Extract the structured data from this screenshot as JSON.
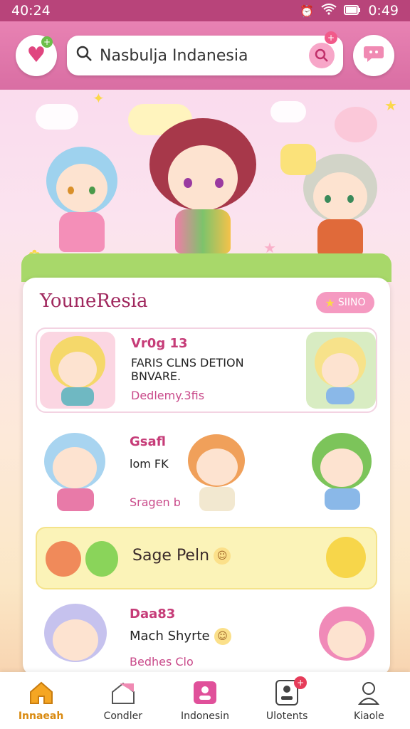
{
  "status_bar": {
    "time": "40:24",
    "battery": "0:49"
  },
  "header": {
    "search_text": "Nasbulja Indanesia"
  },
  "card": {
    "title": "YouneResia",
    "pill_label": "SIINO",
    "rows": [
      {
        "line1": "Vr0g 13",
        "line2": "FARIS CLNS DETION BNVARE.",
        "line3": "Dedlemy.3fis"
      },
      {
        "line1": "Gsafl",
        "line2": "lom FK",
        "line3": "Sragen b"
      },
      {
        "label": "Sage Peln"
      },
      {
        "line1": "Daa83",
        "line2": "Mach Shyrte",
        "line3": "Bedhes Clo"
      }
    ]
  },
  "nav": [
    {
      "label": "Innaeah",
      "icon": "home-icon"
    },
    {
      "label": "Condler",
      "icon": "house-icon"
    },
    {
      "label": "Indonesin",
      "icon": "person-card-icon"
    },
    {
      "label": "Ulotents",
      "icon": "id-card-icon"
    },
    {
      "label": "Kiaole",
      "icon": "profile-icon"
    }
  ],
  "colors": {
    "accent": "#d96ea3",
    "active_nav": "#d98a10"
  }
}
